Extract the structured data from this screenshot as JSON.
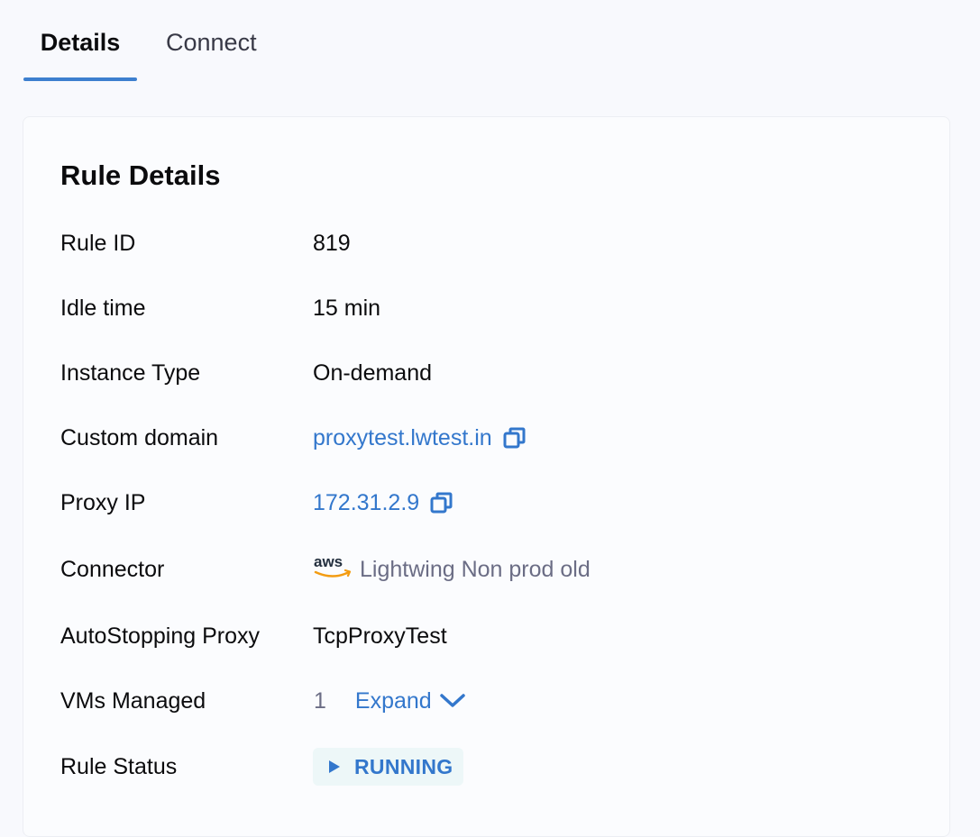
{
  "tabs": [
    {
      "label": "Details",
      "active": true
    },
    {
      "label": "Connect",
      "active": false
    }
  ],
  "card": {
    "title": "Rule Details",
    "rows": {
      "rule_id": {
        "label": "Rule ID",
        "value": "819"
      },
      "idle_time": {
        "label": "Idle time",
        "value": "15 min"
      },
      "instance_type": {
        "label": "Instance Type",
        "value": "On-demand"
      },
      "custom_domain": {
        "label": "Custom domain",
        "value": "proxytest.lwtest.in",
        "icon": "copy-icon"
      },
      "proxy_ip": {
        "label": "Proxy IP",
        "value": "172.31.2.9",
        "icon": "copy-icon"
      },
      "connector": {
        "label": "Connector",
        "logo_text": "aws",
        "value": "Lightwing Non prod old",
        "icon": "aws-logo-icon"
      },
      "autostopping_proxy": {
        "label": "AutoStopping Proxy",
        "value": "TcpProxyTest"
      },
      "vms_managed": {
        "label": "VMs Managed",
        "count": "1",
        "expand_label": "Expand",
        "icon": "chevron-down-icon"
      },
      "rule_status": {
        "label": "Rule Status",
        "value": "RUNNING",
        "icon": "play-icon"
      }
    }
  },
  "colors": {
    "accent": "#3377cc",
    "tab_underline": "#3d7fcf",
    "status_bg": "#edf7f8",
    "aws_orange": "#f39c12",
    "muted_text": "#6b6d85"
  }
}
